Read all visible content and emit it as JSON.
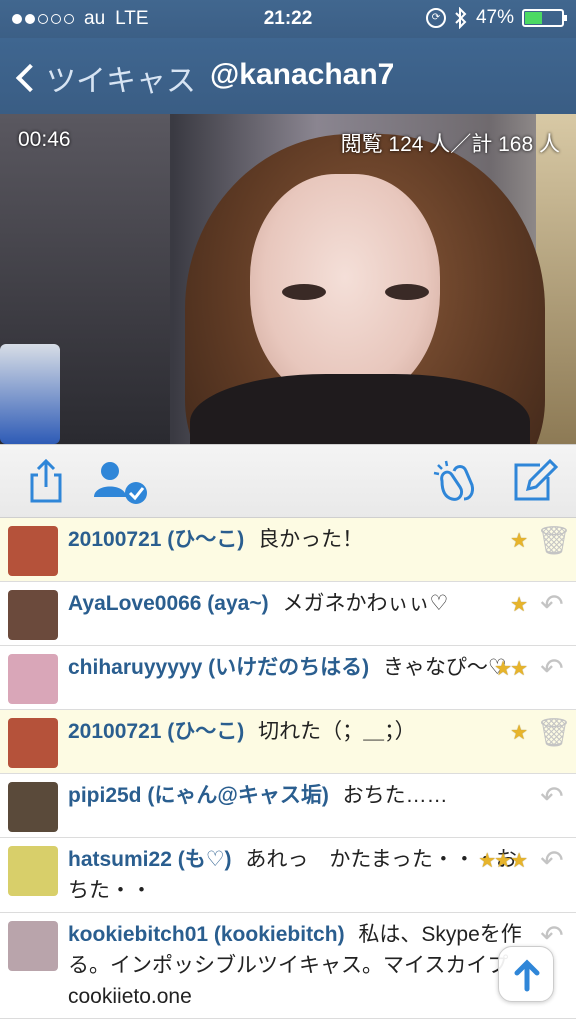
{
  "status_bar": {
    "carrier": "au",
    "network": "LTE",
    "time": "21:22",
    "battery": "47%",
    "signal_bars_filled": 2,
    "signal_bars_total": 5,
    "battery_level_pct": 47,
    "battery_color": "#4cd964"
  },
  "nav": {
    "back_label": "ツイキャス",
    "title": "@kanachan7",
    "bar_color": "#3c5f86"
  },
  "video": {
    "elapsed": "00:46",
    "viewers": "閲覧 124 人／計 168 人"
  },
  "toolbar": {
    "icons": [
      "share-icon",
      "follow-user-icon",
      "clap-icon",
      "compose-icon"
    ],
    "accent": "#2f86d8"
  },
  "comments": [
    {
      "user": "20100721 (ひ〜こ)",
      "text": "良かった！",
      "stars": "★",
      "action_icon": "trash-icon",
      "highlight": true,
      "avatar_color": "#b5523a"
    },
    {
      "user": "AyaLove0066 (aya~)",
      "text": "メガネかわぃぃ♡",
      "stars": "★",
      "action_icon": "reply-icon",
      "highlight": false,
      "avatar_color": "#6b4a3c"
    },
    {
      "user": "chiharuyyyyy (いけだのちはる)",
      "text": "きゃなぴ〜♡",
      "stars": "★★",
      "action_icon": "reply-icon",
      "highlight": false,
      "avatar_color": "#d9a6b8"
    },
    {
      "user": "20100721 (ひ〜こ)",
      "text": "切れた（；＿；）",
      "stars": "★",
      "action_icon": "trash-icon",
      "highlight": true,
      "avatar_color": "#b5523a"
    },
    {
      "user": "pipi25d (にゃん@キャス垢)",
      "text": "おちた……",
      "stars": "",
      "action_icon": "reply-icon",
      "highlight": false,
      "avatar_color": "#5a4a3a"
    },
    {
      "user": "hatsumi22 (も♡)",
      "text": "あれっ　かたまった・・・おちた・・",
      "stars": "★★★",
      "action_icon": "reply-icon",
      "highlight": false,
      "avatar_color": "#d8cf6a"
    },
    {
      "user": "kookiebitch01 (kookiebitch)",
      "text": "私は、Skypeを作る。インポッシブルツイキャス。マイスカイプcookiieto.one",
      "stars": "",
      "action_icon": "reply-icon",
      "highlight": false,
      "avatar_color": "#b9a4ab"
    }
  ],
  "scroll_top_icon": "arrow-up-icon"
}
